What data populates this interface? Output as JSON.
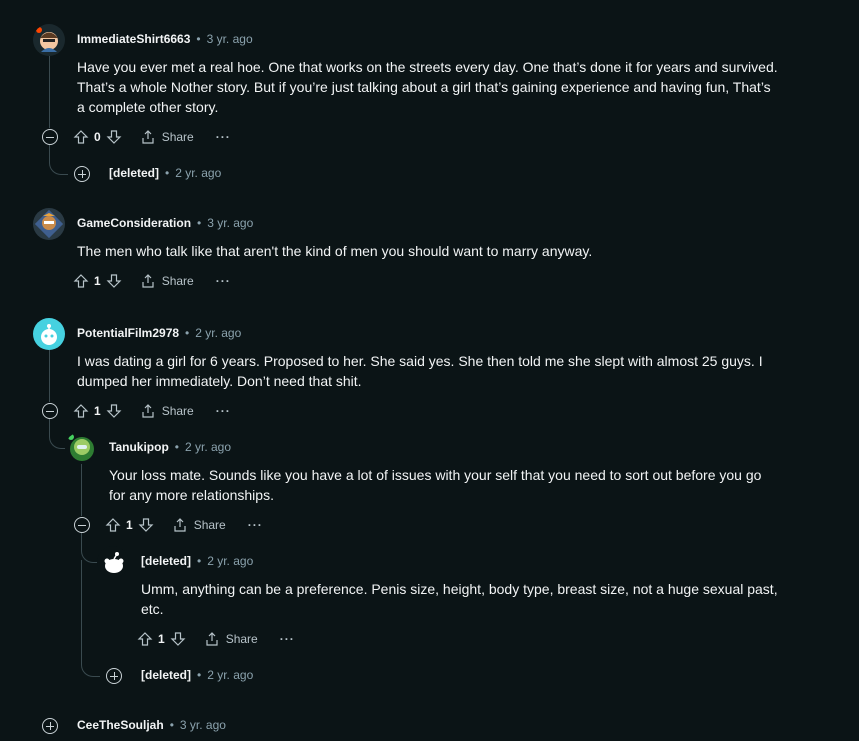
{
  "comments": [
    {
      "user": "ImmediateShirt6663",
      "time": "3 yr. ago",
      "text": "Have you ever met a real hoe. One that works on the streets every day. One that’s done it for years and survived. That’s a whole Nother story. But if you’re just talking about a girl that’s gaining experience and having fun, That’s a complete other story.",
      "score": "0",
      "share": "Share",
      "more": "···"
    },
    {
      "user": "[deleted]",
      "time": "2 yr. ago"
    },
    {
      "user": "GameConsideration",
      "time": "3 yr. ago",
      "text": "The men who talk like that aren't the kind of men you should want to marry anyway.",
      "score": "1",
      "share": "Share",
      "more": "···"
    },
    {
      "user": "PotentialFilm2978",
      "time": "2 yr. ago",
      "text": "I was dating a girl for 6 years. Proposed to her. She said yes. She then told me she slept with almost 25 guys. I dumped her immediately. Don’t need that shit.",
      "score": "1",
      "share": "Share",
      "more": "···"
    },
    {
      "user": "Tanukipop",
      "time": "2 yr. ago",
      "text": "Your loss mate. Sounds like you have a lot of issues with your self that you need to sort out before you go for any more relationships.",
      "score": "1",
      "share": "Share",
      "more": "···"
    },
    {
      "user": "[deleted]",
      "time": "2 yr. ago",
      "text": "Umm, anything can be a preference. Penis size, height, body type, breast size, not a huge sexual past, etc.",
      "score": "1",
      "share": "Share",
      "more": "···"
    },
    {
      "user": "[deleted]",
      "time": "2 yr. ago"
    },
    {
      "user": "CeeTheSouljah",
      "time": "3 yr. ago"
    }
  ],
  "sep": "•",
  "colors": {
    "background": "#0b1416",
    "text": "#f2f4f5",
    "meta": "#8ba2ad",
    "thread": "#3a4a4f"
  }
}
